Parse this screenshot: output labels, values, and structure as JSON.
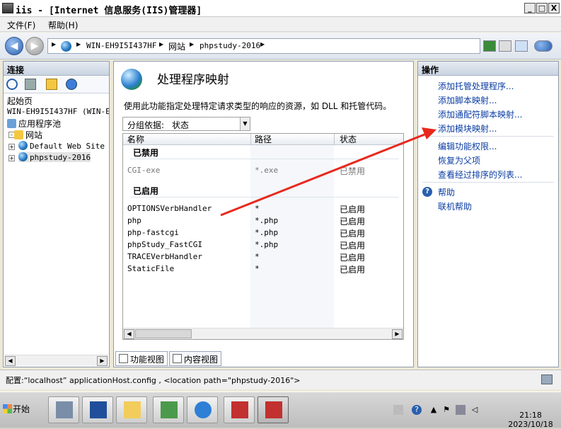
{
  "window": {
    "title": "iis - [Internet 信息服务(IIS)管理器]",
    "minimize": "_",
    "maximize": "□",
    "close": "X"
  },
  "menu": {
    "file": "文件(F)",
    "help": "帮助(H)"
  },
  "breadcrumb": [
    "WIN-EH9I5I437HF",
    "网站",
    "phpstudy-2016"
  ],
  "left": {
    "title": "连接",
    "tree": {
      "start_page": "起始页",
      "server": "WIN-EH9I5I437HF (WIN-EH9",
      "app_pools": "应用程序池",
      "sites": "网站",
      "site1": "Default Web Site",
      "site2": "phpstudy-2016"
    }
  },
  "center": {
    "title": "处理程序映射",
    "description": "使用此功能指定处理特定请求类型的响应的资源，如 DLL 和托管代码。",
    "group_label": "分组依据:",
    "group_value": "状态",
    "columns": [
      "名称",
      "路径",
      "状态"
    ],
    "disabled_group": "已禁用",
    "disabled_rows": [
      {
        "name": "CGI-exe",
        "path": "*.exe",
        "state": "已禁用"
      }
    ],
    "enabled_group": "已启用",
    "enabled_rows": [
      {
        "name": "OPTIONSVerbHandler",
        "path": "*",
        "state": "已启用"
      },
      {
        "name": "php",
        "path": "*.php",
        "state": "已启用"
      },
      {
        "name": "php-fastcgi",
        "path": "*.php",
        "state": "已启用"
      },
      {
        "name": "phpStudy_FastCGI",
        "path": "*.php",
        "state": "已启用"
      },
      {
        "name": "TRACEVerbHandler",
        "path": "*",
        "state": "已启用"
      },
      {
        "name": "StaticFile",
        "path": "*",
        "state": "已启用"
      }
    ],
    "tab_features": "功能视图",
    "tab_content": "内容视图"
  },
  "right": {
    "title": "操作",
    "actions": [
      "添加托管处理程序...",
      "添加脚本映射...",
      "添加通配符脚本映射...",
      "添加模块映射..."
    ],
    "actions2": [
      "编辑功能权限...",
      "恢复为父项",
      "查看经过排序的列表..."
    ],
    "help": "帮助",
    "online_help": "联机帮助"
  },
  "status": {
    "text": "配置:“localhost” applicationHost.config , <location path=\"phpstudy-2016\">"
  },
  "taskbar": {
    "start": "开始",
    "time": "21:18",
    "date": "2023/10/18"
  },
  "colors": {
    "link": "#0a3ca3",
    "arrow": "#e8281d"
  }
}
